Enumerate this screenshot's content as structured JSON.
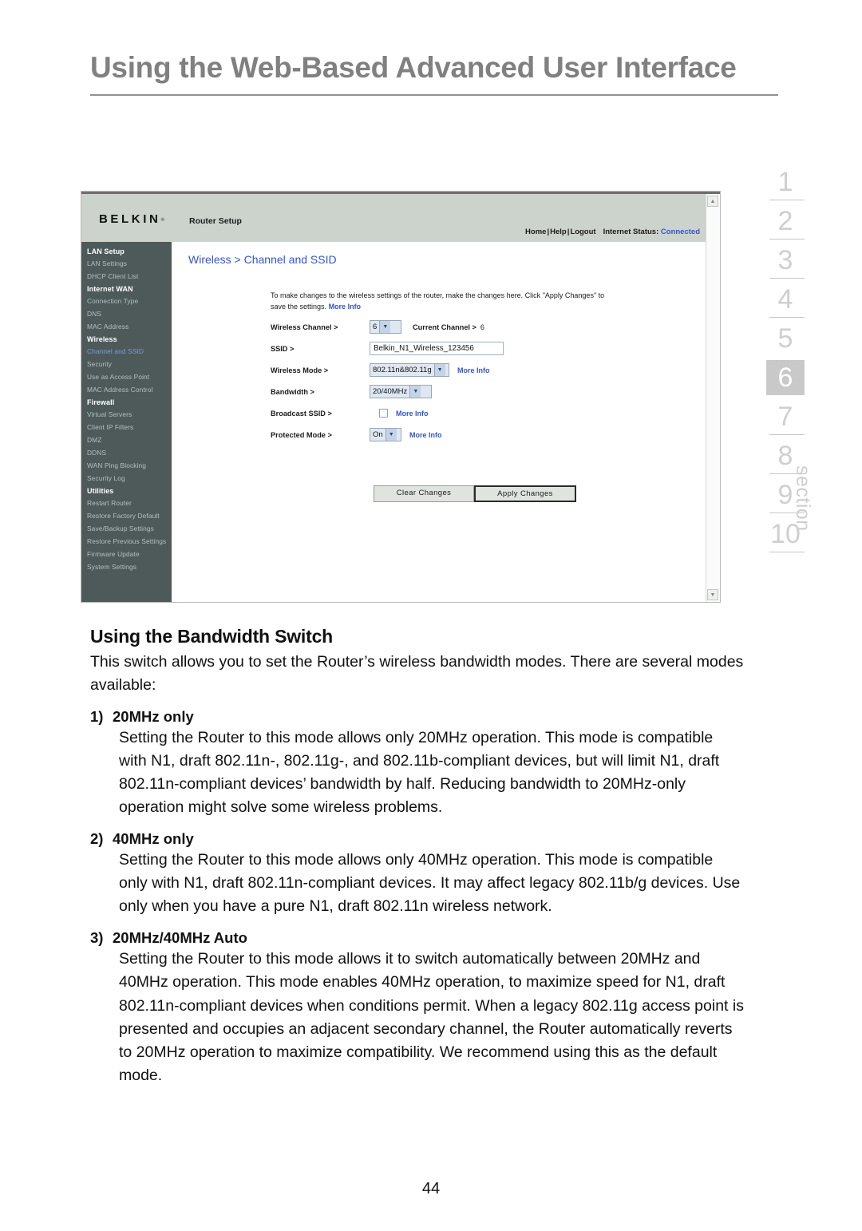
{
  "page": {
    "title": "Using the Web-Based Advanced User Interface",
    "number": "44"
  },
  "section_rail": {
    "word": "section",
    "numbers": [
      "1",
      "2",
      "3",
      "4",
      "5",
      "6",
      "7",
      "8",
      "9",
      "10"
    ],
    "active": "6",
    "active_bg": "#c9c9c9",
    "inactive_color": "#cfcfcf"
  },
  "router_ui": {
    "brand": "BELKIN",
    "brand_mark": "®",
    "app_name": "Router Setup",
    "top_links": {
      "home": "Home",
      "help": "Help",
      "logout": "Logout",
      "separator": "|",
      "status_label": "Internet Status:",
      "status_value": "Connected",
      "status_color": "#3355cc"
    },
    "sidebar": {
      "bg": "#4e5a5a",
      "groups": [
        {
          "heading": "LAN Setup",
          "items": [
            "LAN Settings",
            "DHCP Client List"
          ]
        },
        {
          "heading": "Internet WAN",
          "items": [
            "Connection Type",
            "DNS",
            "MAC Address"
          ]
        },
        {
          "heading": "Wireless",
          "items": [
            "Channel and SSID",
            "Security",
            "Use as Access Point",
            "MAC Address Control"
          ]
        },
        {
          "heading": "Firewall",
          "items": [
            "Virtual Servers",
            "Client IP Filters",
            "DMZ",
            "DDNS",
            "WAN Ping Blocking",
            "Security Log"
          ]
        },
        {
          "heading": "Utilities",
          "items": [
            "Restart Router",
            "Restore Factory Default",
            "Save/Backup Settings",
            "Restore Previous Settings",
            "Firmware Update",
            "System Settings"
          ]
        }
      ],
      "current_item": "Channel and SSID",
      "current_color": "#6f9ede"
    },
    "breadcrumb": "Wireless > Channel and SSID",
    "breadcrumb_color": "#3355cc",
    "intro": {
      "line1": "To make changes to the wireless settings of the router, make the changes here. Click",
      "line2": "\"Apply Changes\" to save the settings.",
      "more_info": "More Info"
    },
    "fields": {
      "wireless_channel": {
        "label": "Wireless Channel >",
        "value": "6",
        "current_label": "Current Channel >",
        "current_value": "6"
      },
      "ssid": {
        "label": "SSID >",
        "value": "Belkin_N1_Wireless_123456"
      },
      "wireless_mode": {
        "label": "Wireless Mode >",
        "value": "802.11n&802.11g",
        "more_info": "More Info"
      },
      "bandwidth": {
        "label": "Bandwidth >",
        "value": "20/40MHz"
      },
      "broadcast_ssid": {
        "label": "Broadcast SSID >",
        "checked": false,
        "more_info": "More Info"
      },
      "protected_mode": {
        "label": "Protected Mode >",
        "value": "On",
        "more_info": "More Info"
      }
    },
    "buttons": {
      "clear": "Clear Changes",
      "apply": "Apply Changes"
    }
  },
  "article": {
    "heading": "Using the Bandwidth Switch",
    "intro": "This switch allows you to set the Router’s wireless bandwidth modes. There are several modes available:",
    "items": [
      {
        "index": "1)",
        "title": "20MHz only",
        "body": "Setting the Router to this mode allows only 20MHz operation. This mode is compatible with N1, draft 802.11n-, 802.11g-, and 802.11b-compliant devices, but will limit N1, draft 802.11n-compliant devices’ bandwidth by half. Reducing bandwidth to 20MHz-only operation might solve some wireless problems."
      },
      {
        "index": "2)",
        "title": "40MHz only",
        "body": "Setting the Router to this mode allows only 40MHz operation. This mode is compatible only with N1, draft 802.11n-compliant devices. It may affect legacy 802.11b/g devices. Use only when you have a pure N1, draft 802.11n wireless network."
      },
      {
        "index": "3)",
        "title": "20MHz/40MHz Auto",
        "body": "Setting the Router to this mode allows it to switch automatically between 20MHz and 40MHz operation. This mode enables 40MHz operation, to maximize speed for N1, draft 802.11n-compliant devices when conditions permit. When a legacy 802.11g access point is presented and occupies an adjacent secondary channel, the Router automatically reverts to 20MHz operation to maximize compatibility. We recommend using this as the default mode."
      }
    ]
  }
}
